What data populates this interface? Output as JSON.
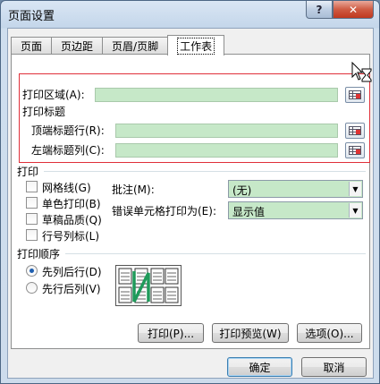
{
  "window": {
    "title": "页面设置",
    "help_label": "?",
    "close_label": "✕"
  },
  "tabs": [
    "页面",
    "页边距",
    "页眉/页脚",
    "工作表"
  ],
  "print_area": {
    "label": "打印区域(A):",
    "value": ""
  },
  "print_titles": {
    "heading": "打印标题",
    "rows_label": "顶端标题行(R):",
    "cols_label": "左端标题列(C):"
  },
  "print": {
    "heading": "打印",
    "checkboxes": [
      {
        "label": "网格线(G)",
        "checked": false
      },
      {
        "label": "单色打印(B)",
        "checked": false
      },
      {
        "label": "草稿品质(Q)",
        "checked": false
      },
      {
        "label": "行号列标(L)",
        "checked": false
      }
    ],
    "comments_label": "批注(M):",
    "comments_value": "(无)",
    "errors_label": "错误单元格打印为(E):",
    "errors_value": "显示值"
  },
  "page_order": {
    "heading": "打印顺序",
    "options": [
      {
        "label": "先列后行(D)",
        "selected": true
      },
      {
        "label": "先行后列(V)",
        "selected": false
      }
    ]
  },
  "panel_buttons": {
    "print": "打印(P)...",
    "preview": "打印预览(W)",
    "options": "选项(O)..."
  },
  "footer": {
    "ok": "确定",
    "cancel": "取消"
  },
  "colors": {
    "field_bg": "#c6e8c8",
    "highlight": "#e0303a"
  }
}
